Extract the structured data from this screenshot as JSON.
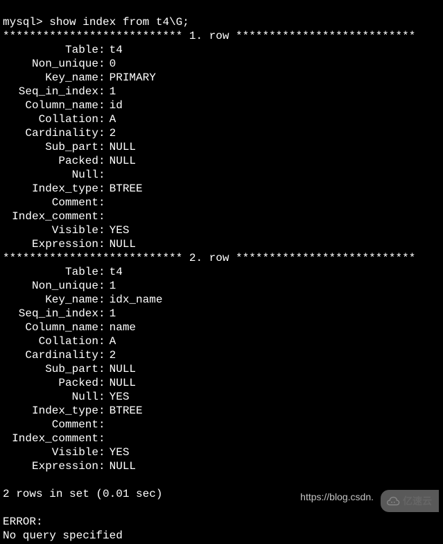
{
  "prompt": "mysql> ",
  "command": "show index from t4\\G;",
  "row_separator_prefix": "*************************** ",
  "row_separator_suffix": " ***************************",
  "rows": [
    {
      "label": "1. row",
      "fields": {
        "Table": "t4",
        "Non_unique": "0",
        "Key_name": "PRIMARY",
        "Seq_in_index": "1",
        "Column_name": "id",
        "Collation": "A",
        "Cardinality": "2",
        "Sub_part": "NULL",
        "Packed": "NULL",
        "Null": "",
        "Index_type": "BTREE",
        "Comment": "",
        "Index_comment": "",
        "Visible": "YES",
        "Expression": "NULL"
      }
    },
    {
      "label": "2. row",
      "fields": {
        "Table": "t4",
        "Non_unique": "1",
        "Key_name": "idx_name",
        "Seq_in_index": "1",
        "Column_name": "name",
        "Collation": "A",
        "Cardinality": "2",
        "Sub_part": "NULL",
        "Packed": "NULL",
        "Null": "YES",
        "Index_type": "BTREE",
        "Comment": "",
        "Index_comment": "",
        "Visible": "YES",
        "Expression": "NULL"
      }
    }
  ],
  "field_order": [
    "Table",
    "Non_unique",
    "Key_name",
    "Seq_in_index",
    "Column_name",
    "Collation",
    "Cardinality",
    "Sub_part",
    "Packed",
    "Null",
    "Index_type",
    "Comment",
    "Index_comment",
    "Visible",
    "Expression"
  ],
  "summary": "2 rows in set (0.01 sec)",
  "error_label": "ERROR:",
  "error_message": "No query specified",
  "watermark": "https://blog.csdn.",
  "brand": "亿速云"
}
